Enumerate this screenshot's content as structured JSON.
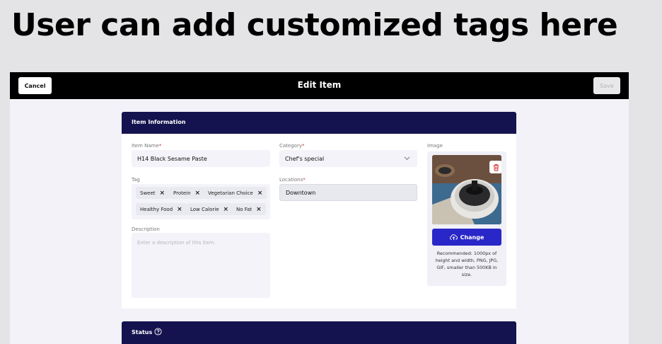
{
  "caption": "User can add customized tags here",
  "topbar": {
    "title": "Edit Item",
    "cancel_label": "Cancel",
    "save_label": "Save"
  },
  "item_info": {
    "header": "Item Information",
    "name_label": "Item Name",
    "name_value": "H14 Black Sesame Paste",
    "category_label": "Category",
    "category_value": "Chef's special",
    "image_label": "Image",
    "tag_label": "Tag",
    "tags": [
      "Sweet",
      "Protein",
      "Vegetarian Choice",
      "Healthy Food",
      "Low Calorie",
      "No Fat"
    ],
    "locations_label": "Locations",
    "locations_value": "Downtown",
    "description_label": "Description",
    "description_placeholder": "Enter a description of this item.",
    "change_label": "Change",
    "recommendation": "Recommended: 1000px of height and width, PNG, JPG, GIF, smaller than 500KB in size."
  },
  "status": {
    "header": "Status"
  },
  "icons": {
    "chevron": "chevron-down-icon",
    "trash": "trash-icon",
    "upload": "cloud-upload-icon",
    "help": "question-circle-icon",
    "remove": "close-icon"
  },
  "colors": {
    "header_navy": "#15134f",
    "primary_blue": "#2a27c8",
    "required_red": "#d32f2f"
  }
}
